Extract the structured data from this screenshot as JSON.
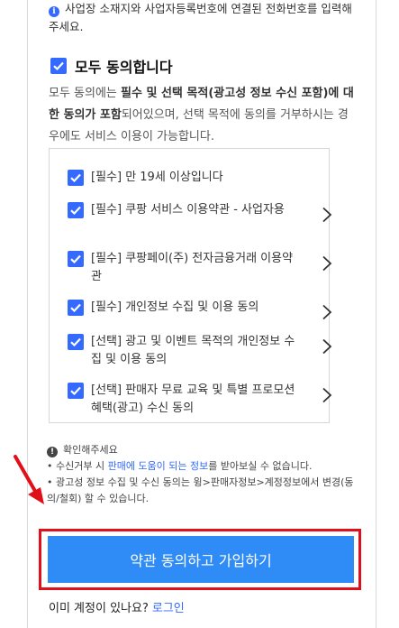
{
  "notice": {
    "text": "사업장 소재지와 사업자등록번호에 연결된 전화번호를 입력해 주세요.",
    "icon": "info-icon"
  },
  "agree_all": {
    "label": "모두 동의합니다",
    "checked": true
  },
  "description": {
    "part1": "모두 동의에는 ",
    "bold1": "필수 및 선택 목적(광고성 정보 수신 포함)에 대한 동의가 포함",
    "part2": "되어있으며, 선택 목적에 동의를 거부하시는 경우에도 서비스 이용이 가능합니다."
  },
  "terms": [
    {
      "label": "[필수] 만 19세 이상입니다",
      "checked": true,
      "has_detail": false
    },
    {
      "label": "[필수] 쿠팡 서비스 이용약관 - 사업자용",
      "checked": true,
      "has_detail": true
    },
    {
      "label": "[필수] 쿠팡페이(주) 전자금융거래 이용약관",
      "checked": true,
      "has_detail": true
    },
    {
      "label": "[필수] 개인정보 수집 및 이용 동의",
      "checked": true,
      "has_detail": true
    },
    {
      "label": "[선택] 광고 및 이벤트 목적의 개인정보 수집 및 이용 동의",
      "checked": true,
      "has_detail": true
    },
    {
      "label": "[선택] 판매자 무료 교육 및 특별 프로모션 혜택(광고) 수신 동의",
      "checked": true,
      "has_detail": true
    }
  ],
  "notes": {
    "title": "확인해주세요",
    "line1_a": "• 수신거부 시 ",
    "line1_b": "판매에 도움이 되는 정보",
    "line1_c": "를 받아보실 수 없습니다.",
    "line2": "• 광고성 정보 수집 및 수신 동의는 윙>판매자정보>계정정보에서 변경(동의/철회) 할 수 있습니다."
  },
  "submit_label": "약관 동의하고 가입하기",
  "login": {
    "prompt": "이미 계정이 있나요?",
    "link": "로그인"
  },
  "colors": {
    "accent": "#346aff",
    "button": "#2f8cf6",
    "highlight": "#e0101a"
  }
}
